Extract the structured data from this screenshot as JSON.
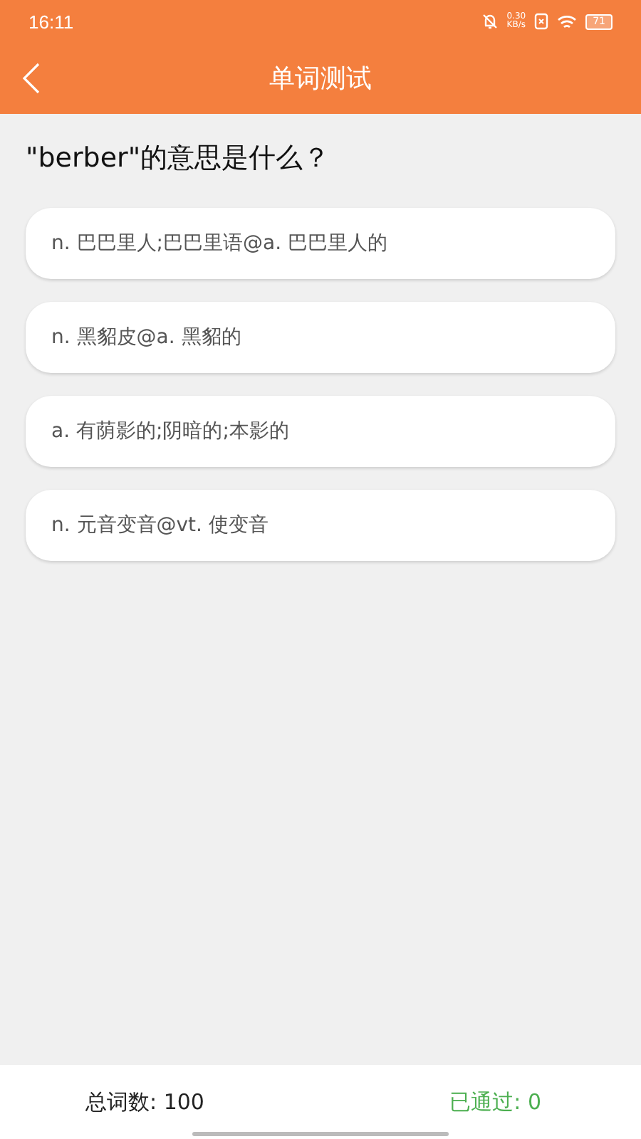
{
  "status_bar": {
    "time": "16:11",
    "net_speed": "0.30",
    "net_unit": "KB/s",
    "battery": "71"
  },
  "header": {
    "title": "单词测试"
  },
  "question": "\"berber\"的意思是什么？",
  "options": [
    {
      "text": "n. 巴巴里人;巴巴里语@a. 巴巴里人的"
    },
    {
      "text": "n. 黑貂皮@a. 黑貂的"
    },
    {
      "text": "a. 有荫影的;阴暗的;本影的"
    },
    {
      "text": "n. 元音变音@vt. 使变音"
    }
  ],
  "footer": {
    "total": "总词数: 100",
    "passed": "已通过: 0"
  }
}
